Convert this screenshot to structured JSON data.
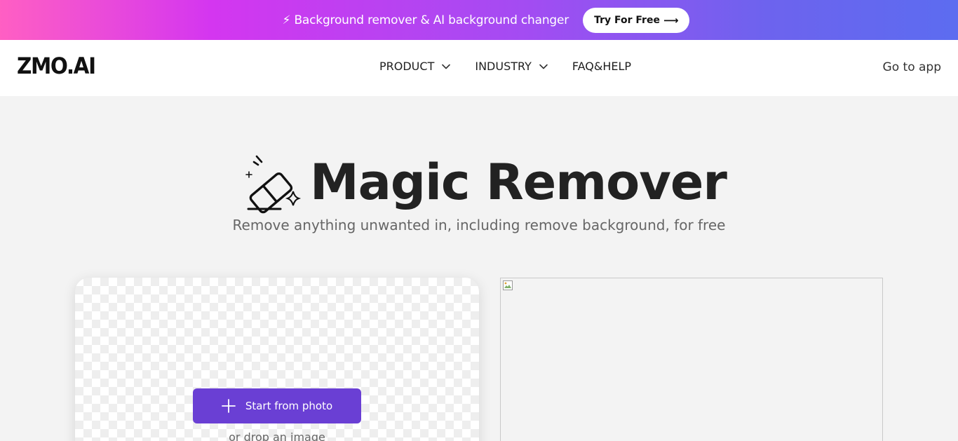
{
  "banner": {
    "text": "⚡ Background remover & AI background changer",
    "button_label": "Try For Free",
    "button_arrow": "⟶"
  },
  "nav": {
    "logo": "ZMO.AI",
    "items": [
      {
        "label": "PRODUCT",
        "has_dropdown": true
      },
      {
        "label": "INDUSTRY",
        "has_dropdown": true
      },
      {
        "label": "FAQ&HELP",
        "has_dropdown": false
      }
    ],
    "go_app": "Go to app"
  },
  "hero": {
    "title": "Magic Remover",
    "subtitle": "Remove anything unwanted in, including remove background, for free",
    "icon": "eraser-sparkle-icon"
  },
  "upload": {
    "button_label": "Start from photo",
    "drop_text": "or drop an image"
  },
  "preview": {
    "icon": "broken-image-icon"
  },
  "colors": {
    "accent": "#6a3fd4",
    "banner_start": "#ff5fc3",
    "banner_end": "#5c6cf0"
  }
}
